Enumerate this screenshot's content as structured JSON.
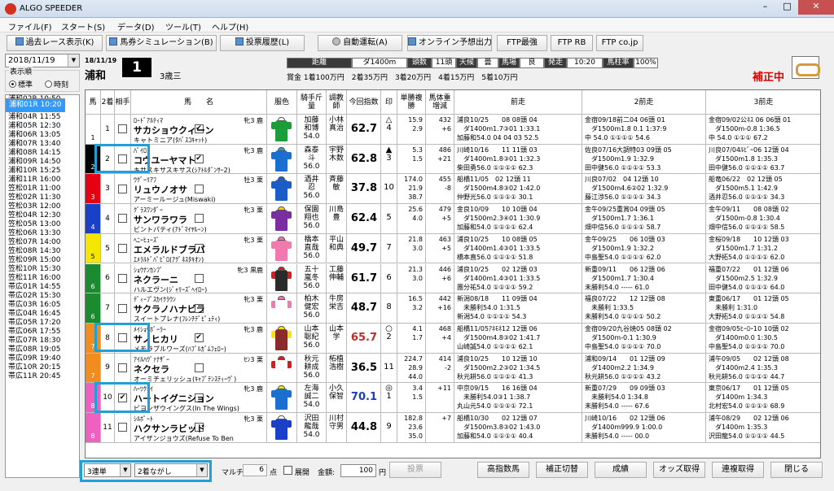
{
  "window": {
    "title": "ALGO SPEEDER"
  },
  "menu": [
    "ファイル(F)",
    "スタート(S)",
    "データ(D)",
    "ツール(T)",
    "ヘルプ(H)"
  ],
  "toolbar": {
    "past_race": "過去レース表示(K)",
    "sim": "馬券シミュレーション(B)",
    "history": "投票履歴(L)",
    "auto": "自動運転(A)",
    "online": "オンライン予想出力",
    "ftp1": "FTP最強",
    "ftp2": "FTP RB",
    "ftp3": "FTP co.jp"
  },
  "left": {
    "date": "2018/11/19",
    "order_label": "表示順",
    "opt_std": "標準",
    "opt_time": "時刻",
    "races": [
      "浦和01R 10:20",
      "浦和02R 10:50",
      "浦和03R 11:20",
      "浦和04R 11:55",
      "浦和05R 12:30",
      "浦和06R 13:05",
      "浦和07R 13:40",
      "浦和08R 14:15",
      "浦和09R 14:50",
      "浦和10R 15:25",
      "浦和11R 16:00",
      "笠松01R 11:00",
      "笠松02R 11:30",
      "笠松03R 12:00",
      "笠松04R 12:30",
      "笠松05R 13:00",
      "笠松06R 13:30",
      "笠松07R 14:00",
      "笠松08R 14:30",
      "笠松09R 15:00",
      "笠松10R 15:30",
      "笠松11R 16:00",
      "帯広01R 14:55",
      "帯広02R 15:30",
      "帯広03R 16:05",
      "帯広04R 16:45",
      "帯広05R 17:20",
      "帯広06R 17:55",
      "帯広07R 18:30",
      "帯広08R 19:05",
      "帯広09R 19:40",
      "帯広10R 20:15",
      "帯広11R 20:45"
    ]
  },
  "race": {
    "date": "18/11/19",
    "venue": "浦和",
    "num": "1",
    "class": "3歳三",
    "dist_label": "距離",
    "dist": "ダ1400m",
    "heads_label": "頭数",
    "heads": "11頭",
    "weather_label": "天候",
    "weather": "曇",
    "track_label": "馬場",
    "track": "良",
    "post_label": "発走",
    "post": "10:20",
    "share_label": "馬柱率",
    "share": "100%",
    "prize": "賞金 1着100万円　2着35万円　3着20万円　4着15万円　5着10万円",
    "hosei": "補正中"
  },
  "columns": [
    "馬",
    "2着",
    "相手",
    "馬　　名",
    "服色",
    "騎手斤量",
    "調教師",
    "今回指数",
    "印",
    "単勝複勝",
    "馬体重増減",
    "前走",
    "2前走",
    "3前走"
  ],
  "horses": [
    {
      "frame": "1",
      "fc": "#ffffff",
      "ft": "#000",
      "no": "1",
      "c2": false,
      "ai": true,
      "sire": "ﾛｰﾄﾞｱﾙﾃｨﾏ",
      "sx": "牝3 鹿",
      "name": "サカショウクィーン",
      "dam": "キャトミニア(ﾀﾊﾞｽｺｷｬｯﾄ)",
      "silk": [
        "#ffffff",
        "#1a9e3a",
        "#1a9e3a"
      ],
      "jockey": "加藤\n和博\n54.0",
      "trainer": "小林\n真治",
      "idx": "62.7",
      "idxc": "#000",
      "mark": "△\n4",
      "odds": "15.9\n2.9",
      "wt": "432\n+6",
      "p1": "浦良10/25　　08 08頭 04\n　ダ1400m1.7③01 1:33.1\n加藤和54.0 04 04 03 52.5",
      "p2": "金宿09/18前二04 06頭 01\n　ダ1500m1.8 0.1 1:37:9\n中 54.0 ①①①① 54.6",
      "p3": "金宿09/02公ﾈｽ 06 06頭 01\n　ダ1500m-0.8 1:36.5\n中 54.0 ①①① 67.2"
    },
    {
      "frame": "2",
      "fc": "#000000",
      "ft": "#fff",
      "no": "2",
      "c2": false,
      "ai": true,
      "sire": "ﾊﾟｲﾛ",
      "sx": "牝3 鹿",
      "name": "コウユーヤマト",
      "dam": "キサスキサスキサス(ｼｱﾄﾙﾀﾞﾝｻｰ2)",
      "silk": [
        "#1fa4d9",
        "#1a6fd0",
        "#1a6fd0"
      ],
      "jockey": "森泰\n斗\n56.0",
      "trainer": "宇野\n木数",
      "idx": "62.8",
      "idxc": "#000",
      "mark": "▲\n3",
      "odds": "5.3\n1.5",
      "wt": "486\n+21",
      "p1": "川崎10/16　　11 11頭 03\n　ダ1400m1.8③01 1:32.3\n柴田勇56.0 ①①①① 62.3",
      "p2": "佐良07/16大調特03 09頭 05\n　ダ1500m1.9 1:32.9\n田中健56.0 ①①①① 53.3",
      "p3": "川良07/04ﾙﾋﾞｰ06 12頭 04\n　ダ1500m1.8 1:35.3\n田中健56.0 ①①①① 63.7"
    },
    {
      "frame": "3",
      "fc": "#e60012",
      "ft": "#fff",
      "no": "3",
      "c2": false,
      "ai": false,
      "sire": "ｳｸﾞｰﾘｱﾌ",
      "sx": "牡3 栗",
      "name": "リュウノオサ",
      "dam": "アーミールージュ(Miswaki)",
      "silk": [
        "#1a5cc8",
        "#1a5cc8",
        "#1a5cc8"
      ],
      "jockey": "酒井\n忍\n56.0",
      "trainer": "斉藤\n敏",
      "idx": "37.8",
      "idxc": "#000",
      "mark": "\n10",
      "odds": "174.0\n21.9\n38.7",
      "wt": "455\n-8",
      "p1": "船橋11/05　02 12頭 11\n　ダ1500m4.8③02 1:42.0\n仲野光56.0 ①①①① 30.1",
      "p2": "川良07/02　04 12頭 10\n　ダ1500m4.6②02 1:32.9\n藤江渉56.0 ①①①① 34.3",
      "p3": "船竜06/22　02 12頭 05\n　ダ1500m5.1 1:42.9\n酒井忍56.0 ①①①① 34.3"
    },
    {
      "frame": "4",
      "fc": "#1a3fc8",
      "ft": "#fff",
      "no": "4",
      "c2": false,
      "ai": false,
      "sire": "ｸﾞﾗｽﾜﾝﾀﾞｰ",
      "sx": "牝3 栗",
      "name": "サンワラワラ",
      "dam": "ビントパティ(ｱﾄﾞﾏｲﾔﾙｰﾝ)",
      "silk": [
        "#f5d000",
        "#7a2fa0",
        "#7a2fa0"
      ],
      "jockey": "保園\n翔也\n56.0",
      "trainer": "川島\n豊",
      "idx": "62.4",
      "idxc": "#000",
      "mark": "\n5",
      "odds": "25.6\n4.0",
      "wt": "479\n+5",
      "p1": "金良10/09　　10 10頭 04\n　ダ1500m2.3④01 1:30.9\n加藤和54.0 ①①①① 62.4",
      "p2": "金午09/25重賞04 09頭 05\n　ダ1500m1.7 1:36.1\n畑中信56.0 ①①①① 58.7",
      "p3": "金午09/11　　08 08頭 02\n　ダ1500m-0.8 1:30.4\n畑中信56.0 ①①①① 58.5"
    },
    {
      "frame": "5",
      "fc": "#f5e600",
      "ft": "#000",
      "no": "5",
      "c2": false,
      "ai": false,
      "sire": "ﾍﾆｰﾋｭｰｽﾞ",
      "sx": "牝3 栗",
      "name": "エメラルドブラバ",
      "dam": "ｴﾒﾗﾙﾄﾞﾊﾟﾋﾟﾛ(ｱｸﾞﾈｽﾀｷｵﾝ)",
      "silk": [
        "#f07ab0",
        "#f07ab0",
        "#f07ab0"
      ],
      "jockey": "橋本\n直哉\n56.0",
      "trainer": "平山\n和典",
      "idx": "49.7",
      "idxc": "#000",
      "mark": "\n7",
      "odds": "21.8\n3.0",
      "wt": "463\n+5",
      "p1": "浦良10/25　　10 08頭 05\n　ダ1400m1.4③01 1:33.5\n橋本直56.0 ①①①① 51.8",
      "p2": "金午09/25　　06 10頭 03\n　ダ1500m1.9 1:32.2\n中島聖54.0 ①①①① 62.0",
      "p3": "金桜09/18　　10 12頭 03\n　ダ1500m1.7 1:31.2\n大野拓54.0 ①①①① 62.0"
    },
    {
      "frame": "6",
      "fc": "#1a8c2f",
      "ft": "#fff",
      "no": "6",
      "c2": false,
      "ai": false,
      "sire": "ｼｮｳﾅﾝｶﾝﾌﾟ",
      "sx": "牝3 黒鹿",
      "name": "ネクラーニ",
      "dam": "ハルエヴン(ｼﾞｬﾘｰｽﾞﾍｲﾛｰ)",
      "silk": [
        "#d71e1e",
        "#2a2a2a",
        "#d71e1e"
      ],
      "jockey": "五十\n嵐冬\n56.0",
      "trainer": "工藤\n伸輔",
      "idx": "61.7",
      "idxc": "#000",
      "mark": "\n6",
      "odds": "21.3\n3.0",
      "wt": "446\n+6",
      "p1": "浦良10/25　　02 12頭 03\n　ダ1400m1.4③01 1:33.5\n團分祐54.0 ①①①① 59.2",
      "p2": "新重09/11　　06 12頭 06\n　ダ1500m1.7 1:30.4\n未勝利54.0 ----- 61.0",
      "p3": "福重07/22　　01 12頭 06\n　ダ1500m2.5 1:32.9\n田中健54.0 ①①①① 64.0"
    },
    {
      "frame": "6",
      "fc": "#1a8c2f",
      "ft": "#fff",
      "no": "7",
      "c2": false,
      "ai": false,
      "sire": "ﾃﾞｨｰﾌﾟｽｶｲｸﾗｳﾝ",
      "sx": "牝3 栗",
      "name": "サクラノハナビラ",
      "dam": "スイートプレナ(ﾌﾚﾝﾁﾃﾞﾋﾟｭﾃｨ)",
      "silk": [
        "#f07ab0",
        "#ffffff",
        "#f07ab0"
      ],
      "jockey": "柏木\n健宏\n56.0",
      "trainer": "牛房\n栄吉",
      "idx": "48.7",
      "idxc": "#000",
      "mark": "\n8",
      "odds": "16.5\n3.2",
      "wt": "442\n+16",
      "p1": "新潟08/18　　11 09頭 04\n　未勝利54.0 1:31.5\n新潟54.0 ①①①① 54.3",
      "p2": "福良07/22　　12 12頭 08\n　未勝利 1:33.5\n未勝利54.0 ①①①① 50.2",
      "p3": "東重06/17　　01 12頭 05\n　未勝利 1:31.0\n大野拓54.0 ①①①① 54.8"
    },
    {
      "frame": "7",
      "fc": "#f28c1e",
      "ft": "#fff",
      "no": "8",
      "c2": false,
      "ai": true,
      "sire": "ﾒｲｼｮｳﾎﾞｰﾗｰ",
      "sx": "牝3 鹿",
      "name": "サノヒカリ",
      "dam": "メモラブルワーズ(ﾊﾌﾞﾙｶﾞﾑﾌｪﾛｰ)",
      "silk": [
        "#f5e600",
        "#8a2a2a",
        "#f5e600"
      ],
      "jockey": "山本\n聡紀\n56.0",
      "trainer": "山本\n学",
      "idx": "65.7",
      "idxc": "#c62828",
      "mark": "○\n2",
      "odds": "4.1\n1.7",
      "wt": "468\n+4",
      "p1": "船橋11/05ｱﾈﾓﾈ12 12頭 06\n　ダ1500m4.8③02 1:41.7\n山崎誠54.0 ①①①① 62.1",
      "p2": "金宿09/20九谷焼05 08頭 02\n　ダ1500m-0.1 1:30.9\n中島聖54.0 ①①①① 70.0",
      "p3": "金宿09/05ﾋｰﾛｰ10 10頭 02\n　ダ1400m0.0 1:30.5\n中島聖54.0 ①①①① 70.0"
    },
    {
      "frame": "7",
      "fc": "#f28c1e",
      "ft": "#fff",
      "no": "9",
      "c2": false,
      "ai": false,
      "sire": "ｱｲﾙﾊｳﾞｧﾅｻﾞｰ",
      "sx": "ｾﾝ3 栗",
      "name": "ネクセラ",
      "dam": "オーミチェリッシュ(ｷｬﾌﾟﾃﾝｽﾃｨｰｳﾞ)",
      "silk": [
        "#d71e1e",
        "#ffffff",
        "#d71e1e"
      ],
      "jockey": "秋元\n耕成\n56.0",
      "trainer": "柘植\n浩樹",
      "idx": "36.5",
      "idxc": "#000",
      "mark": "\n11",
      "odds": "224.7\n28.9\n44.0",
      "wt": "414\n-2",
      "p1": "浦良10/25　　10 12頭 10\n　ダ1500m2.2③02 1:34.5\n秋元耕56.0 ①①①① 41.3",
      "p2": "浦和09/14　　01 12頭 09\n　ダ1400m2.2 1:34.9\n秋元耕56.0 ①①①① 43.2",
      "p3": "浦午09/05　　02 12頭 08\n　ダ1400m2.4 1:35.3\n秋元耕56.0 ①①①① 44.7"
    },
    {
      "frame": "8",
      "fc": "#f060c0",
      "ft": "#fff",
      "no": "10",
      "c2": true,
      "ai": false,
      "sire": "ﾊｰﾂｸﾗｲ",
      "sx": "牝3 鹿",
      "name": "ハートイグニション",
      "dam": "ビヨンザウイングス(In The Wings)",
      "silk": [
        "#f5e600",
        "#1a6fd0",
        "#1a6fd0"
      ],
      "jockey": "左海\n誠二\n54.0",
      "trainer": "小久\n保智",
      "idx": "70.1",
      "idxc": "#1a3fb8",
      "mark": "◎\n1",
      "odds": "3.4\n1.5",
      "wt": "+11",
      "p1": "中京09/15　　16 16頭 04\n　未勝利54.0③1 1:38.7\n丸山元54.0 ①①①① 72.1",
      "p2": "新重07/29　　09 09頭 03\n　未勝利54.0 1:34.8\n未勝利54.0 ----- 67.6",
      "p3": "東京06/17　　01 12頭 05\n　ダ1400m 1:34.3\n北村宏54.0 ①①①① 68.9"
    },
    {
      "frame": "8",
      "fc": "#f060c0",
      "ft": "#fff",
      "no": "11",
      "c2": false,
      "ai": false,
      "sire": "ｼﾙﾎﾟｰﾄ",
      "sx": "牝3 栗",
      "name": "ハクサンラビッド",
      "dam": "アイザンジョウズ(Refuse To Ben",
      "silk": [
        "#ffffff",
        "#1a3fc8",
        "#1a3fc8"
      ],
      "jockey": "沢田\n龍哉\n54.0",
      "trainer": "川村\n守男",
      "idx": "44.8",
      "idxc": "#000",
      "mark": "\n9",
      "odds": "182.8\n23.6\n35.0",
      "wt": "+7",
      "p1": "船橋10/30　　02 12頭 07\n　ダ1500m3.8③02 1:43.0\n加藤和54.0 ①①①① 40.4",
      "p2": "川崎10/16　　02 12頭 06\n　ダ1400m999.9 1:00.0\n未勝利54.0 ----- 00.0",
      "p3": "浦午08/29　　02 12頭 06\n　ダ1400m 1:35.3\n沢田龍54.0 ①①①① 44.5"
    }
  ],
  "footer": {
    "bet_type": "3連単",
    "bet_mode": "2着ながし",
    "multi": "マルチ",
    "points": "6",
    "points_unit": "点",
    "expand": "展開",
    "amount_label": "金額:",
    "amount": "100",
    "yen": "円",
    "vote": "投票",
    "btn_high": "高指数馬",
    "btn_hosei": "補正切替",
    "btn_seiseki": "成績",
    "btn_odds": "オッズ取得",
    "btn_renpuku": "連複取得",
    "btn_close": "閉じる"
  }
}
